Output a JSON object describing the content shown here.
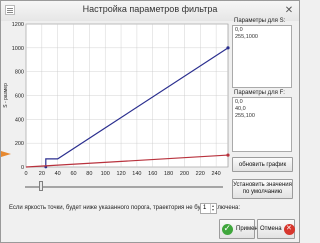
{
  "window": {
    "title": "Настройка параметров фильтра"
  },
  "chart_data": {
    "type": "line",
    "xlim": [
      0,
      255
    ],
    "ylim": [
      0,
      1200
    ],
    "x_ticks": [
      "0",
      "20",
      "40",
      "60",
      "80",
      "100",
      "120",
      "140",
      "160",
      "180",
      "200",
      "220",
      "240"
    ],
    "y_ticks": [
      "0",
      "200",
      "400",
      "600",
      "800",
      "1000",
      "1200"
    ],
    "ylabel": "S - размер",
    "grid": true,
    "series": [
      {
        "color": "#2b2f8f",
        "x": [
          25,
          25,
          40,
          255
        ],
        "y": [
          0,
          68,
          68,
          1000
        ]
      },
      {
        "color": "#b8323d",
        "x": [
          0,
          255
        ],
        "y": [
          0,
          100
        ]
      }
    ]
  },
  "params_s": {
    "label": "Параметры для S:",
    "text": "0,0\n255,1000"
  },
  "params_f": {
    "label": "Параметры для F:",
    "text": "0,0\n40,0\n255,100"
  },
  "buttons": {
    "refresh": "обновить график",
    "defaults": "Установить значения по умолчанию",
    "apply": "Применить",
    "cancel": "Отмена"
  },
  "threshold_text": "Если яркость точки, будет ниже указанного порога, траектория не будет включена:",
  "threshold_value": "1"
}
